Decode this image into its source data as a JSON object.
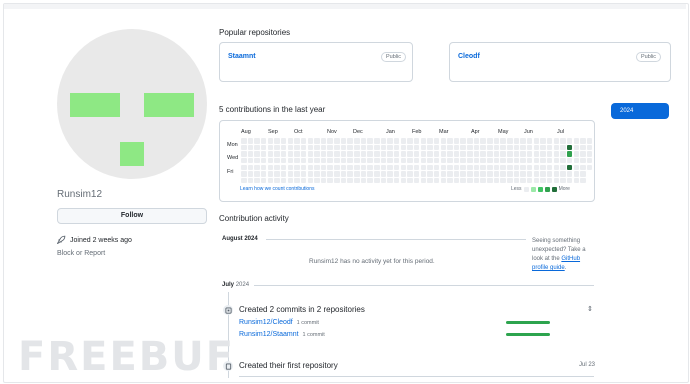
{
  "profile": {
    "username": "Runsim12",
    "follow_label": "Follow",
    "joined": "Joined 2 weeks ago",
    "block_report": "Block or Report"
  },
  "popular": {
    "title": "Popular repositories",
    "repos": [
      {
        "name": "Staamnt",
        "visibility": "Public"
      },
      {
        "name": "Cleodf",
        "visibility": "Public"
      }
    ]
  },
  "contributions": {
    "title": "5 contributions in the last year",
    "year_button": "2024",
    "months": [
      "Aug",
      "Sep",
      "Oct",
      "Nov",
      "Dec",
      "Jan",
      "Feb",
      "Mar",
      "Apr",
      "May",
      "Jun",
      "Jul"
    ],
    "days": [
      "Mon",
      "Wed",
      "Fri"
    ],
    "learn": "Learn how we count contributions",
    "less": "Less",
    "more": "More",
    "active_cells": [
      {
        "week": 49,
        "day": 1,
        "level": 4
      },
      {
        "week": 49,
        "day": 2,
        "level": 3
      },
      {
        "week": 49,
        "day": 4,
        "level": 4
      }
    ],
    "colors": [
      "#ebedf0",
      "#9be9a8",
      "#40c463",
      "#30a14e",
      "#216e39"
    ]
  },
  "activity": {
    "title": "Contribution activity",
    "aug_month": "August 2024",
    "aug_empty": "Runsim12 has no activity yet for this period.",
    "aside_text": "Seeing something unexpected? Take a look at the",
    "aside_link": "GitHub profile guide",
    "aside_end": ".",
    "jul_label": "July",
    "jul_year": "2024",
    "commits_title": "Created 2 commits in 2 repositories",
    "commit_rows": [
      {
        "repo": "Runsim12/Cleodf",
        "count": "1 commit"
      },
      {
        "repo": "Runsim12/Staamnt",
        "count": "1 commit"
      }
    ],
    "created_title": "Created their first repository",
    "created_date": "Jul 23"
  },
  "watermark": "FREEBUF"
}
